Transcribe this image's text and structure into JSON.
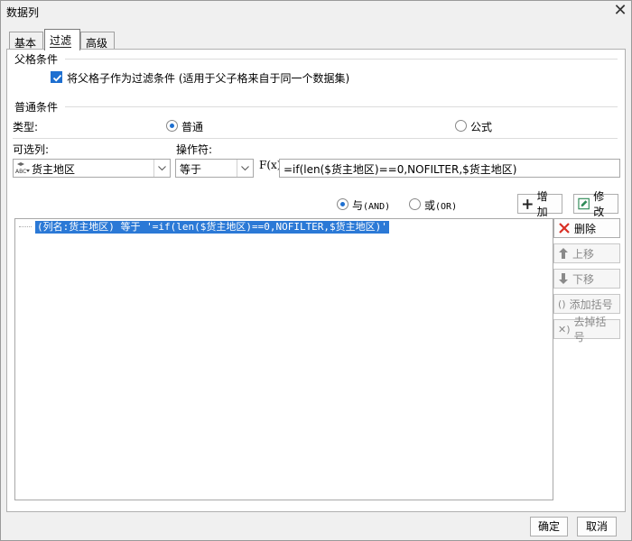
{
  "window": {
    "title": "数据列",
    "close_label": "✕"
  },
  "tabs": [
    {
      "label": "基本",
      "active": false
    },
    {
      "label": "过滤",
      "active": true
    },
    {
      "label": "高级",
      "active": false
    }
  ],
  "parent_condition": {
    "section_title": "父格条件",
    "checkbox_label": "将父格子作为过滤条件 (适用于父子格来自于同一个数据集)",
    "checked": true
  },
  "common_condition": {
    "section_title": "普通条件",
    "type_label": "类型:",
    "type_options": [
      {
        "label": "普通",
        "selected": true
      },
      {
        "label": "公式",
        "selected": false
      }
    ],
    "column_label": "可选列:",
    "column_value": "货主地区",
    "operator_label": "操作符:",
    "operator_value": "等于",
    "formula_icon_label": "F(x)",
    "formula_value": "=if(len($货主地区)==0,NOFILTER,$货主地区)"
  },
  "logic": {
    "and_label": "与",
    "and_suffix": "(AND)",
    "or_label": "或",
    "or_suffix": "(OR)",
    "selected": "and"
  },
  "actions": {
    "add_label": "增加",
    "edit_label": "修改",
    "delete_label": "删除",
    "up_label": "上移",
    "down_label": "下移",
    "add_paren_label": "添加括号",
    "remove_paren_label": "去掉括号"
  },
  "conditions": [
    "(列名:货主地区) 等于 '=if(len($货主地区)==0,NOFILTER,$货主地区)'"
  ],
  "footer": {
    "ok_label": "确定",
    "cancel_label": "取消"
  },
  "colors": {
    "accent": "#1e6fd0",
    "selection": "#2b79d6",
    "delete_red": "#d93025",
    "edit_green": "#2e8b57"
  }
}
